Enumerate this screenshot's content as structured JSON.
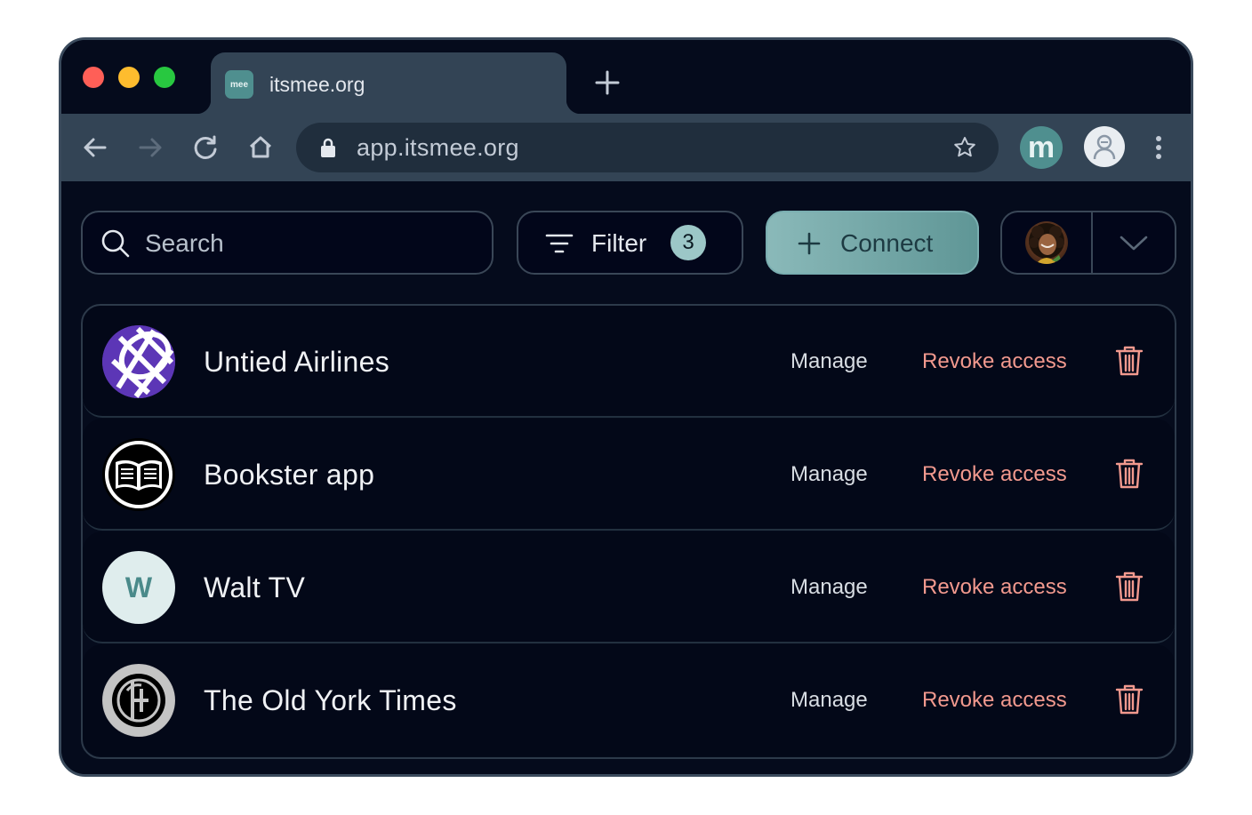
{
  "browser": {
    "tab": {
      "favicon_text": "mee",
      "title": "itsmee.org"
    },
    "address_bar": {
      "url": "app.itsmee.org"
    },
    "extension": {
      "label": "m"
    }
  },
  "toolbar": {
    "search": {
      "placeholder": "Search",
      "value": ""
    },
    "filter": {
      "label": "Filter",
      "count": "3"
    },
    "connect": {
      "label": "Connect"
    }
  },
  "connections": [
    {
      "name": "Untied Airlines",
      "logo_icon": "globe-grid-icon",
      "manage_label": "Manage",
      "revoke_label": "Revoke access"
    },
    {
      "name": "Bookster app",
      "logo_icon": "open-book-icon",
      "manage_label": "Manage",
      "revoke_label": "Revoke access"
    },
    {
      "name": "Walt TV",
      "logo_letter": "W",
      "manage_label": "Manage",
      "revoke_label": "Revoke access"
    },
    {
      "name": "The Old York Times",
      "logo_icon": "newspaper-seal-icon",
      "manage_label": "Manage",
      "revoke_label": "Revoke access"
    }
  ],
  "colors": {
    "accent_teal": "#5f9696",
    "revoke_red": "#f2998e",
    "background": "#050b1c"
  }
}
